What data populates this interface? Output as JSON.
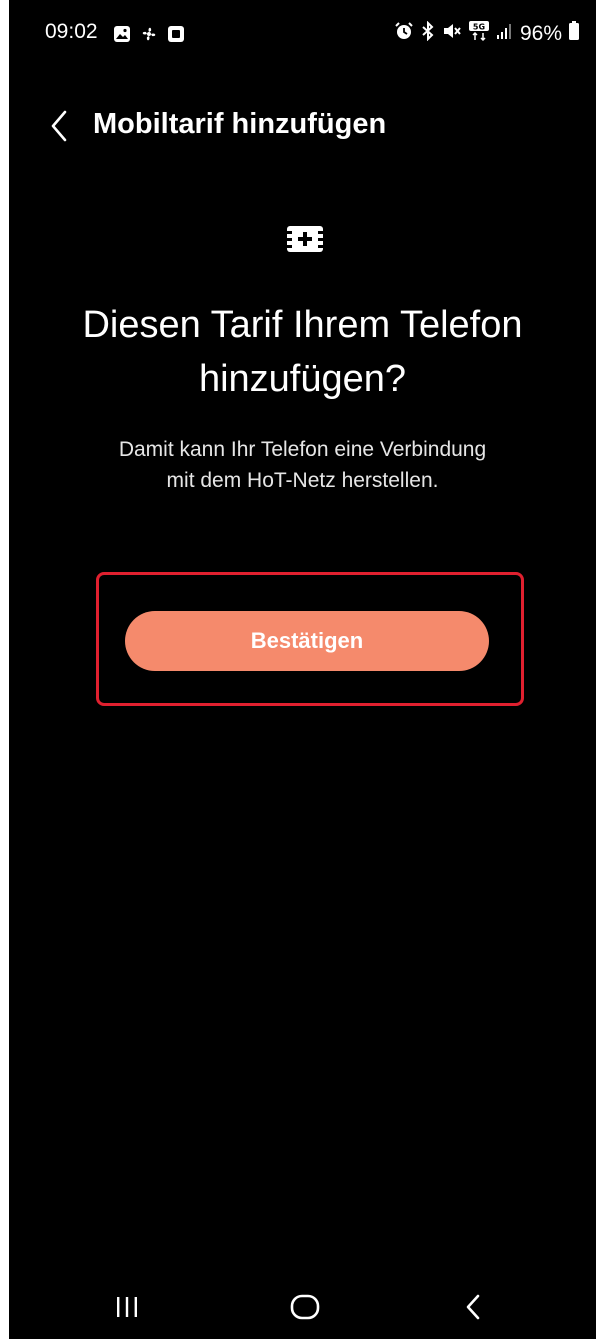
{
  "status_bar": {
    "time": "09:02",
    "battery_percent": "96%",
    "network_badge": "5G",
    "left_icons": [
      "gallery-icon",
      "fan-icon",
      "square-icon"
    ],
    "right_icons": [
      "alarm-icon",
      "bluetooth-icon",
      "mute-icon",
      "network-5g-icon",
      "signal-icon",
      "battery-icon"
    ]
  },
  "header": {
    "title": "Mobiltarif hinzufügen",
    "back_icon": "chevron-left-icon"
  },
  "content": {
    "sim_icon": "sim-add-icon",
    "headline_line1": "Diesen Tarif Ihrem Telefon",
    "headline_line2": "hinzufügen?",
    "description_line1": "Damit kann Ihr Telefon eine Verbindung",
    "description_line2": "mit dem HoT-Netz herstellen.",
    "confirm_label": "Bestätigen"
  },
  "nav_bar": {
    "icons": [
      "recent-apps-icon",
      "home-icon",
      "back-icon"
    ]
  },
  "colors": {
    "background": "#000000",
    "button": "#f58a6c",
    "highlight": "#e0202f"
  }
}
